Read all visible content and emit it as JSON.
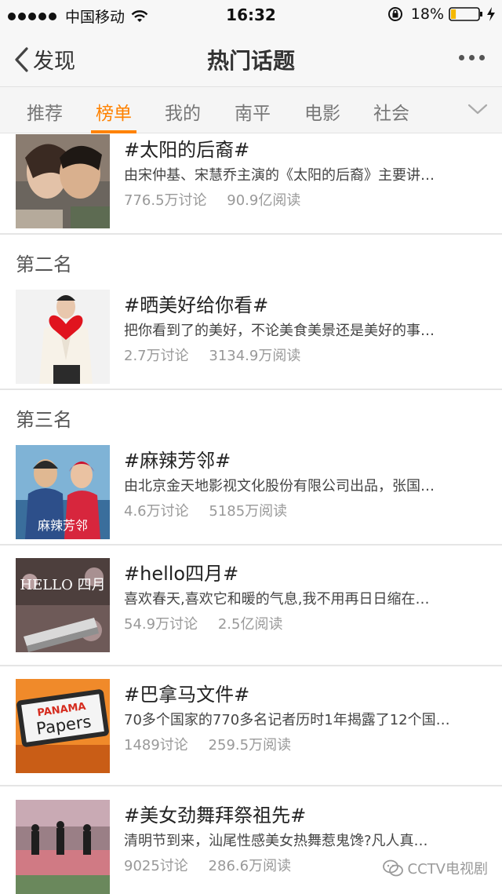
{
  "status_bar": {
    "carrier": "中国移动",
    "time": "16:32",
    "battery_percent": "18%",
    "battery_level": 0.18,
    "signal_bars": 5
  },
  "nav": {
    "back_label": "发现",
    "title": "热门话题"
  },
  "tabs": [
    {
      "label": "推荐",
      "active": false
    },
    {
      "label": "榜单",
      "active": true
    },
    {
      "label": "我的",
      "active": false
    },
    {
      "label": "南平",
      "active": false
    },
    {
      "label": "电影",
      "active": false
    },
    {
      "label": "社会",
      "active": false
    }
  ],
  "colors": {
    "accent": "#ff8200",
    "title_text": "#222222",
    "secondary_text": "#999999"
  },
  "sections": [
    {
      "rank": "",
      "item": {
        "title": "#太阳的后裔#",
        "desc": "由宋仲基、宋慧乔主演的《太阳的后裔》主要讲…",
        "discussions": "776.5万讨论",
        "reads": "90.9亿阅读"
      }
    },
    {
      "rank": "第二名",
      "item": {
        "title": "#晒美好给你看#",
        "desc": "把你看到了的美好，不论美食美景还是美好的事…",
        "discussions": "2.7万讨论",
        "reads": "3134.9万阅读"
      }
    },
    {
      "rank": "第三名",
      "item": {
        "title": "#麻辣芳邻#",
        "desc": "由北京金天地影视文化股份有限公司出品，张国…",
        "discussions": "4.6万讨论",
        "reads": "5185万阅读"
      }
    }
  ],
  "items": [
    {
      "title": "#hello四月#",
      "desc": "喜欢春天,喜欢它和暖的气息,我不用再日日缩在…",
      "discussions": "54.9万讨论",
      "reads": "2.5亿阅读",
      "thumb_text": "HELLO 四月"
    },
    {
      "title": "#巴拿马文件#",
      "desc": "70多个国家的770多名记者历时1年揭露了12个国…",
      "discussions": "1489讨论",
      "reads": "259.5万阅读",
      "thumb_text_1": "PANAMA",
      "thumb_text_2": "Papers"
    },
    {
      "title": "#美女劲舞拜祭祖先#",
      "desc": "清明节到来，汕尾性感美女热舞惹鬼馋?凡人真…",
      "discussions": "9025讨论",
      "reads": "286.6万阅读"
    }
  ],
  "thumb3_text": "麻辣芳邻",
  "watermark": "CCTV电视剧"
}
